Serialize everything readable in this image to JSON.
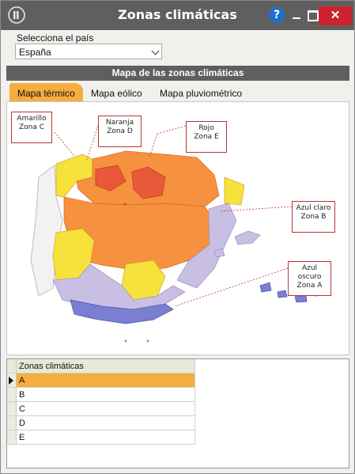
{
  "window": {
    "title": "Zonas climáticas",
    "help_label": "?",
    "close_label": "✕"
  },
  "country": {
    "label": "Selecciona el país",
    "value": "España"
  },
  "section_title": "Mapa de las zonas climáticas",
  "tabs": [
    {
      "label": "Mapa térmico",
      "active": true
    },
    {
      "label": "Mapa eólico",
      "active": false
    },
    {
      "label": "Mapa pluviométrico",
      "active": false
    }
  ],
  "map": {
    "callouts": [
      {
        "line1": "Amarillo",
        "line2": "Zona C"
      },
      {
        "line1": "Naranja",
        "line2": "Zona D"
      },
      {
        "line1": "Rojo",
        "line2": "Zona E"
      },
      {
        "line1": "Azul claro",
        "line2": "Zona B"
      },
      {
        "line1": "Azul",
        "line2": "oscuro",
        "line3": "Zona A"
      }
    ],
    "colors": {
      "yellow": "#f7e23c",
      "orange": "#f5913f",
      "red": "#e8593a",
      "light_blue": "#c9bfe3",
      "dark_blue": "#7a7fd1"
    }
  },
  "grid": {
    "header": "Zonas climáticas",
    "rows": [
      "A",
      "B",
      "C",
      "D",
      "E"
    ],
    "selected_index": 0
  },
  "colors": {
    "titlebar": "#5f5f5f",
    "accent": "#f5ad3e",
    "close": "#c9242b"
  }
}
